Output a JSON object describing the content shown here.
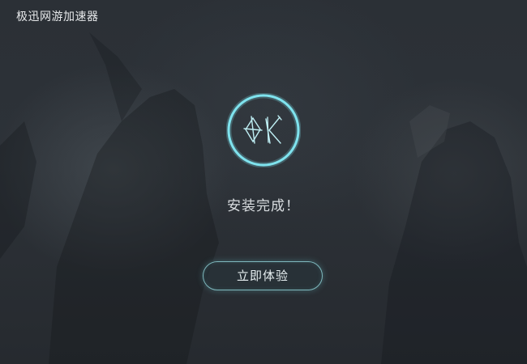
{
  "window": {
    "title": "极迅网游加速器"
  },
  "result": {
    "icon": "ok-check-icon",
    "message": "安装完成！"
  },
  "actions": {
    "start_label": "立即体验"
  },
  "colors": {
    "background": "#2b3036",
    "accent": "#7fe3ee",
    "button_border": "#7fb9be",
    "text": "#d9dde0"
  }
}
